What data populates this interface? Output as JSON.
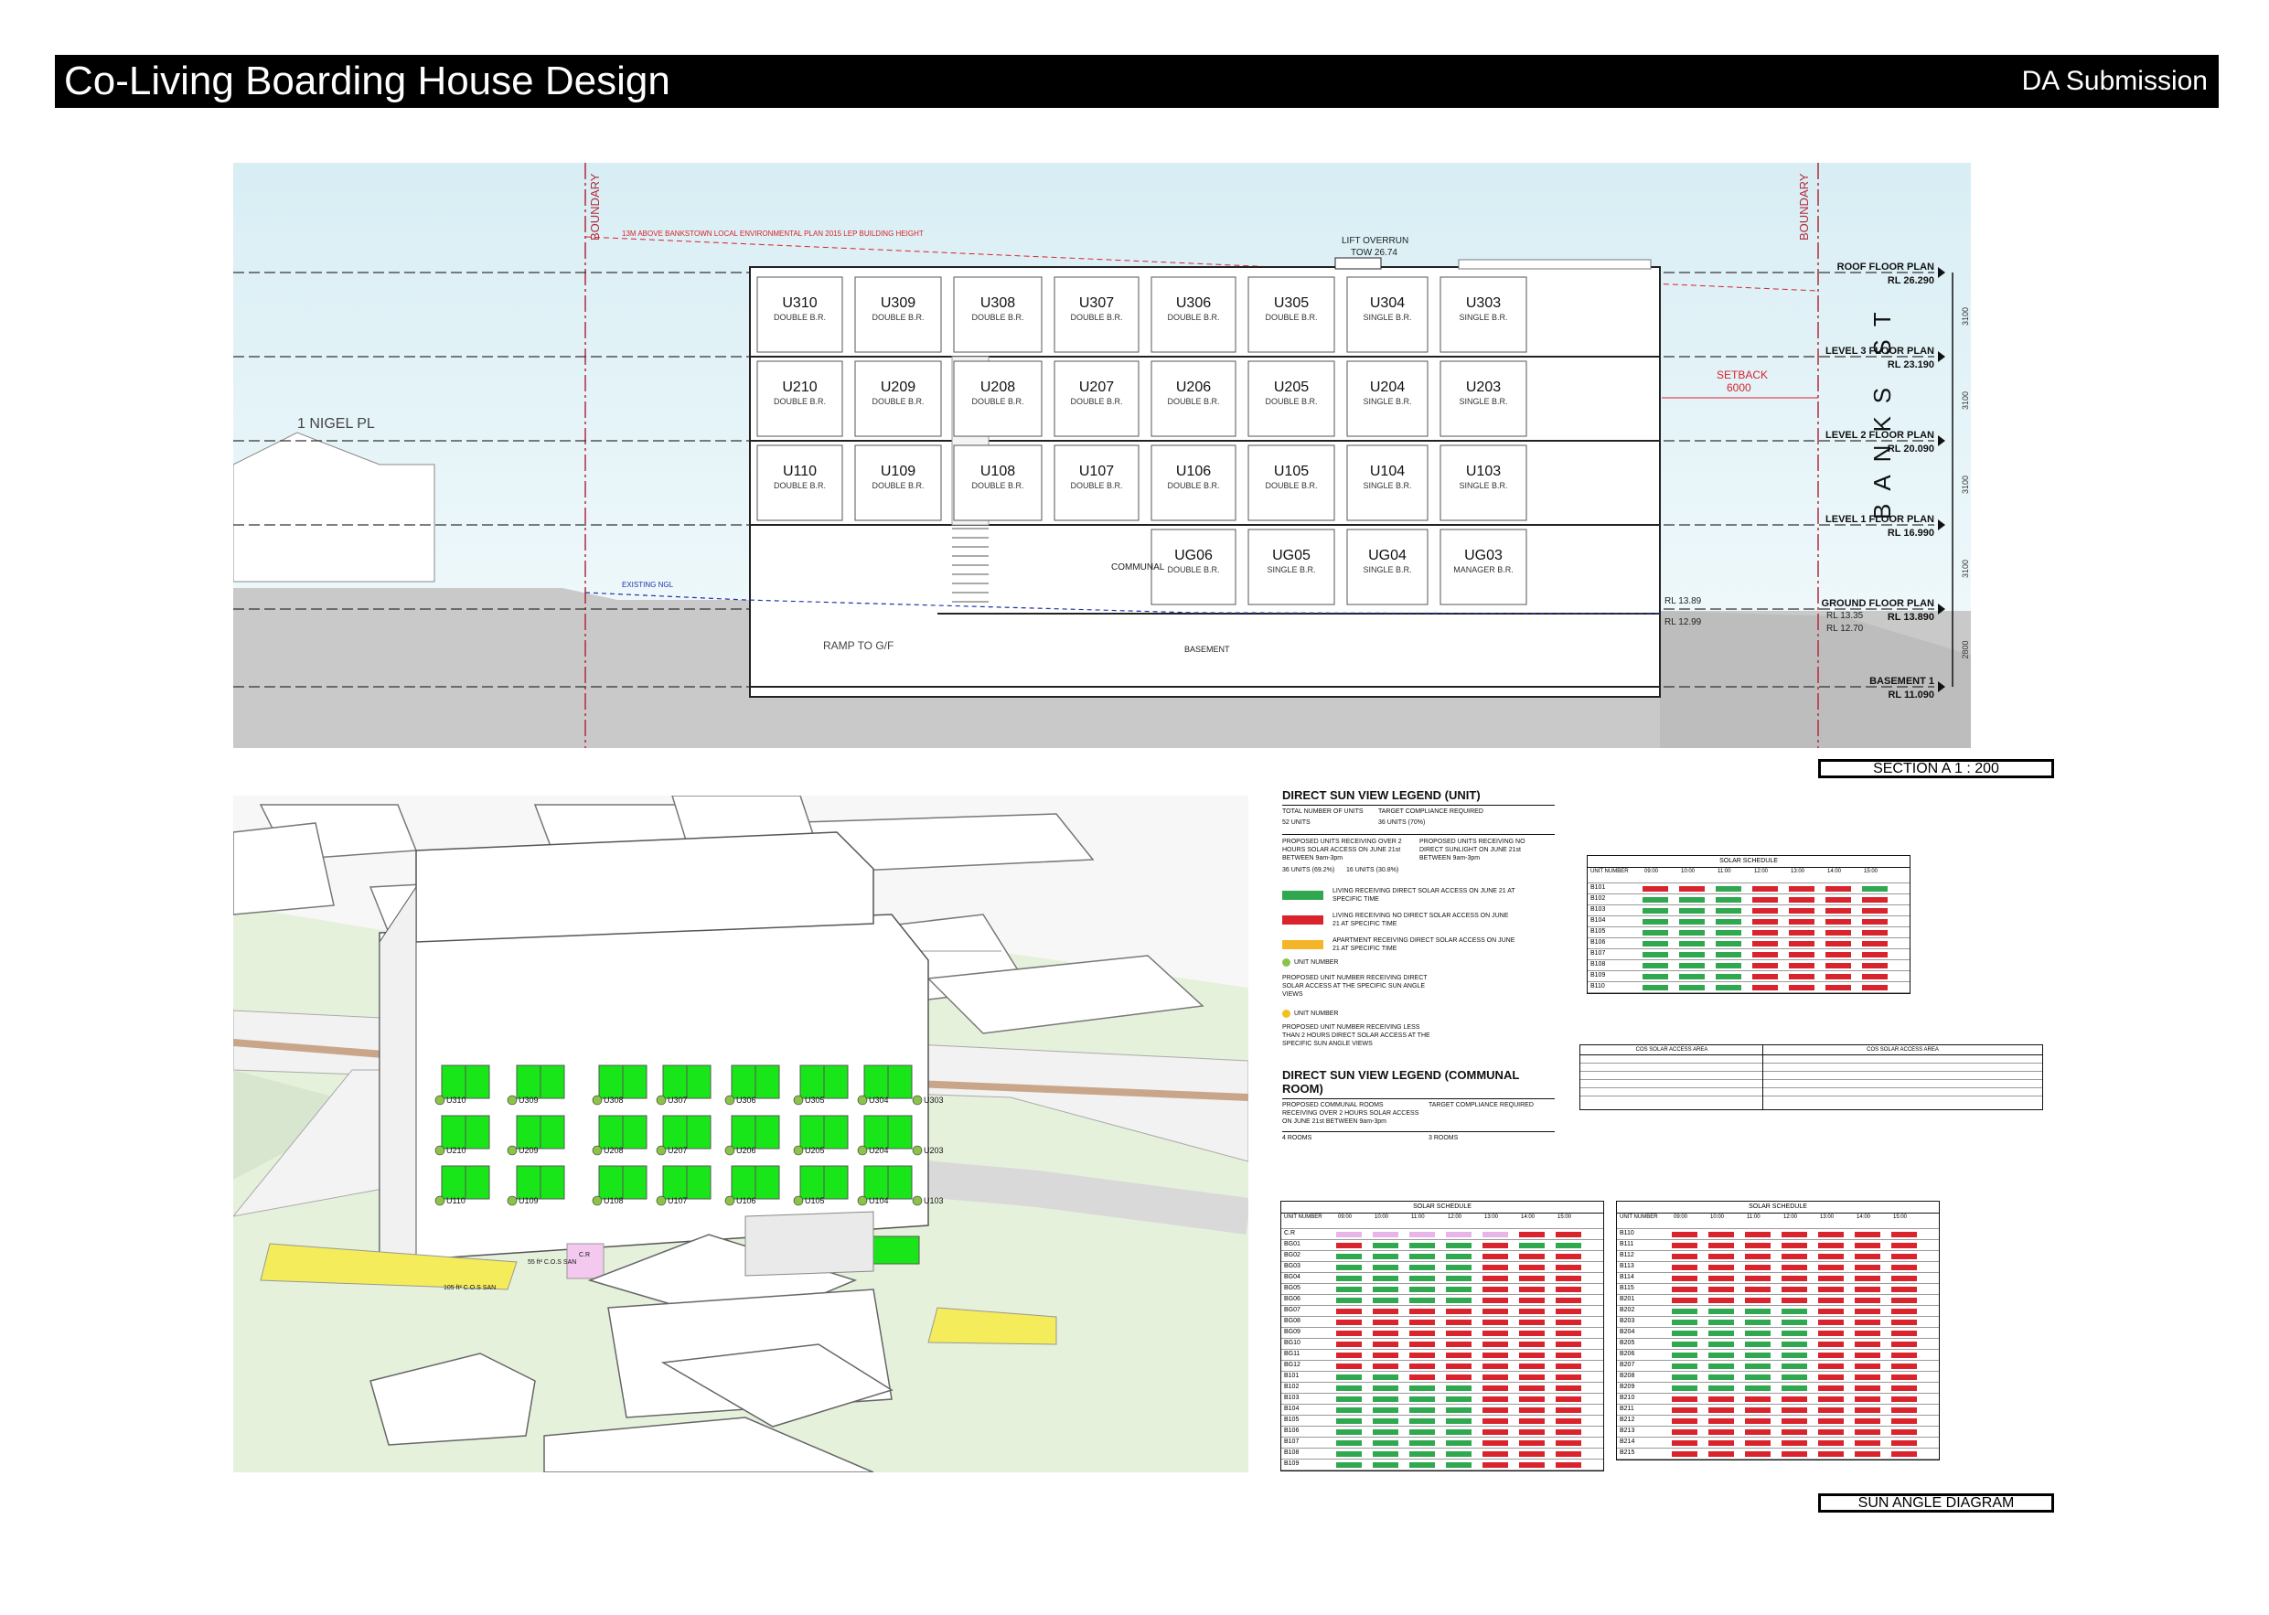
{
  "header": {
    "title": "Co-Living Boarding House Design",
    "subtitle": "DA Submission"
  },
  "section": {
    "boundary_label": "BOUNDARY",
    "height_limit_note": "13M ABOVE BANKSTOWN LOCAL ENVIRONMENTAL PLAN 2015 LEP BUILDING HEIGHT",
    "lift_overrun": "LIFT OVERRUN",
    "tow": "TOW 26.74",
    "neighbour": "1 NIGEL PL",
    "street": "BANKS ST",
    "setback": "SETBACK",
    "setback_value": "6000",
    "existing_ngl": "EXISTING NGL",
    "ramp": "RAMP TO G/F",
    "basement": "BASEMENT",
    "communal": "COMMUNAL",
    "rl_left_1": "RL 13.89",
    "rl_left_2": "RL 12.99",
    "rl_right_1": "RL 13.35",
    "rl_right_2": "RL 12.70",
    "levels": [
      {
        "name": "ROOF FLOOR PLAN",
        "rl": "RL 26.290"
      },
      {
        "name": "LEVEL 3 FLOOR PLAN",
        "rl": "RL 23.190"
      },
      {
        "name": "LEVEL 2 FLOOR PLAN",
        "rl": "RL 20.090"
      },
      {
        "name": "LEVEL 1 FLOOR PLAN",
        "rl": "RL 16.990"
      },
      {
        "name": "GROUND FLOOR PLAN",
        "rl": "RL 13.890"
      },
      {
        "name": "BASEMENT 1",
        "rl": "RL 11.090"
      }
    ],
    "dims": [
      "3100",
      "3100",
      "3100",
      "3100",
      "2800"
    ],
    "units_l3": [
      {
        "id": "U310",
        "type": "DOUBLE B.R."
      },
      {
        "id": "U309",
        "type": "DOUBLE B.R."
      },
      {
        "id": "U308",
        "type": "DOUBLE B.R."
      },
      {
        "id": "U307",
        "type": "DOUBLE B.R."
      },
      {
        "id": "U306",
        "type": "DOUBLE B.R."
      },
      {
        "id": "U305",
        "type": "DOUBLE B.R."
      },
      {
        "id": "U304",
        "type": "SINGLE B.R."
      },
      {
        "id": "U303",
        "type": "SINGLE B.R."
      }
    ],
    "units_l2": [
      {
        "id": "U210",
        "type": "DOUBLE B.R."
      },
      {
        "id": "U209",
        "type": "DOUBLE B.R."
      },
      {
        "id": "U208",
        "type": "DOUBLE B.R."
      },
      {
        "id": "U207",
        "type": "DOUBLE B.R."
      },
      {
        "id": "U206",
        "type": "DOUBLE B.R."
      },
      {
        "id": "U205",
        "type": "DOUBLE B.R."
      },
      {
        "id": "U204",
        "type": "SINGLE B.R."
      },
      {
        "id": "U203",
        "type": "SINGLE B.R."
      }
    ],
    "units_l1": [
      {
        "id": "U110",
        "type": "DOUBLE B.R."
      },
      {
        "id": "U109",
        "type": "DOUBLE B.R."
      },
      {
        "id": "U108",
        "type": "DOUBLE B.R."
      },
      {
        "id": "U107",
        "type": "DOUBLE B.R."
      },
      {
        "id": "U106",
        "type": "DOUBLE B.R."
      },
      {
        "id": "U105",
        "type": "DOUBLE B.R."
      },
      {
        "id": "U104",
        "type": "SINGLE B.R."
      },
      {
        "id": "U103",
        "type": "SINGLE B.R."
      }
    ],
    "units_g": [
      {
        "id": "UG06",
        "type": "DOUBLE B.R."
      },
      {
        "id": "UG05",
        "type": "SINGLE B.R."
      },
      {
        "id": "UG04",
        "type": "SINGLE B.R."
      },
      {
        "id": "UG03",
        "type": "MANAGER B.R."
      }
    ],
    "caption": "SECTION A 1 : 200"
  },
  "aerial": {
    "unit_tags": [
      "U310",
      "U309",
      "U308",
      "U307",
      "U306",
      "U305",
      "U304",
      "U303",
      "U210",
      "U209",
      "U208",
      "U207",
      "U206",
      "U205",
      "U204",
      "U203",
      "U110",
      "U109",
      "U108",
      "U107",
      "U106",
      "U105",
      "U104",
      "U103"
    ],
    "cos_small": "55 ft² C.O.S SAN",
    "cos_main": "105 ft² C.O.S SAN",
    "cr": "C.R"
  },
  "legend_unit": {
    "title": "DIRECT SUN VIEW LEGEND (UNIT)",
    "row1a": "TOTAL NUMBER OF UNITS",
    "row1b": "TARGET COMPLIANCE REQUIRED",
    "row2a": "52 UNITS",
    "row2b": "36 UNITS (70%)",
    "row3a": "PROPOSED UNITS RECEIVING OVER 2 HOURS SOLAR ACCESS ON JUNE 21st BETWEEN 9am-3pm",
    "row3b": "PROPOSED UNITS RECEIVING NO DIRECT SUNLIGHT ON JUNE 21st BETWEEN 9am-3pm",
    "row4a": "36 UNITS (69.2%)",
    "row4b": "16 UNITS (30.8%)",
    "green_text": "LIVING RECEIVING DIRECT SOLAR ACCESS ON JUNE 21 AT SPECIFIC TIME",
    "red_text": "LIVING RECEIVING NO DIRECT SOLAR ACCESS ON JUNE 21 AT SPECIFIC TIME",
    "yellow_text": "APARTMENT RECEIVING DIRECT SOLAR ACCESS ON JUNE 21 AT SPECIFIC TIME",
    "tick_label": "UNIT NUMBER",
    "tick_text": "PROPOSED UNIT NUMBER RECEIVING DIRECT SOLAR ACCESS AT THE SPECIFIC SUN ANGLE VIEWS",
    "tick2_label": "UNIT NUMBER",
    "tick2_text": "PROPOSED UNIT NUMBER RECEIVING LESS THAN 2 HOURS DIRECT SOLAR ACCESS AT THE SPECIFIC SUN ANGLE VIEWS"
  },
  "legend_comm": {
    "title": "DIRECT SUN VIEW LEGEND (COMMUNAL ROOM)",
    "row1a": "PROPOSED COMMUNAL ROOMS RECEIVING OVER 2 HOURS SOLAR ACCESS ON JUNE 21st BETWEEN 9am-3pm",
    "row1b": "TARGET COMPLIANCE REQUIRED",
    "row2a": "4 ROOMS",
    "row2b": "3 ROOMS"
  },
  "schedule_cap": "SOLAR SCHEDULE",
  "sched_head": [
    "UNIT NUMBER",
    "09:00",
    "10:00",
    "11:00",
    "12:00",
    "13:00",
    "14:00",
    "15:00"
  ],
  "schedule1": {
    "rows": [
      {
        "u": "B101",
        "c": "rrgrrrg"
      },
      {
        "u": "B102",
        "c": "gggrrrr"
      },
      {
        "u": "B103",
        "c": "gggrrrr"
      },
      {
        "u": "B104",
        "c": "gggrrrr"
      },
      {
        "u": "B105",
        "c": "gggrrrr"
      },
      {
        "u": "B106",
        "c": "gggrrrr"
      },
      {
        "u": "B107",
        "c": "gggrrrr"
      },
      {
        "u": "B108",
        "c": "gggrrrr"
      },
      {
        "u": "B109",
        "c": "gggrrrr"
      },
      {
        "u": "B110",
        "c": "gggrrrr"
      }
    ]
  },
  "schedule2": {
    "rows": [
      {
        "u": "C.R",
        "c": "ppppprr"
      },
      {
        "u": "BG01",
        "c": "rgggrgg"
      },
      {
        "u": "BG02",
        "c": "ggggrrr"
      },
      {
        "u": "BG03",
        "c": "ggggrrr"
      },
      {
        "u": "BG04",
        "c": "ggggrrr"
      },
      {
        "u": "BG05",
        "c": "ggggrrr"
      },
      {
        "u": "BG06",
        "c": "ggggrrr"
      },
      {
        "u": "BG07",
        "c": "rrrrrrr"
      },
      {
        "u": "BG08",
        "c": "rrrrrrr"
      },
      {
        "u": "BG09",
        "c": "rrrrrrr"
      },
      {
        "u": "BG10",
        "c": "rrrrrrr"
      },
      {
        "u": "BG11",
        "c": "rrrrrrr"
      },
      {
        "u": "BG12",
        "c": "rrrrrrr"
      },
      {
        "u": "B101",
        "c": "ggrrrrr"
      },
      {
        "u": "B102",
        "c": "ggggrrr"
      },
      {
        "u": "B103",
        "c": "ggggrrr"
      },
      {
        "u": "B104",
        "c": "ggggrrr"
      },
      {
        "u": "B105",
        "c": "ggggrrr"
      },
      {
        "u": "B106",
        "c": "ggggrrr"
      },
      {
        "u": "B107",
        "c": "ggggrrr"
      },
      {
        "u": "B108",
        "c": "ggggrrr"
      },
      {
        "u": "B109",
        "c": "ggggrrr"
      }
    ]
  },
  "schedule3": {
    "rows": [
      {
        "u": "B110",
        "c": "rrrrrrr"
      },
      {
        "u": "B111",
        "c": "rrrrrrr"
      },
      {
        "u": "B112",
        "c": "rrrrrrr"
      },
      {
        "u": "B113",
        "c": "rrrrrrr"
      },
      {
        "u": "B114",
        "c": "rrrrrrr"
      },
      {
        "u": "B115",
        "c": "rrrrrrr"
      },
      {
        "u": "B201",
        "c": "rrrrrrr"
      },
      {
        "u": "B202",
        "c": "ggggrrr"
      },
      {
        "u": "B203",
        "c": "ggggrrr"
      },
      {
        "u": "B204",
        "c": "ggggrrr"
      },
      {
        "u": "B205",
        "c": "ggggrrr"
      },
      {
        "u": "B206",
        "c": "ggggrrr"
      },
      {
        "u": "B207",
        "c": "ggggrrr"
      },
      {
        "u": "B208",
        "c": "ggggrrr"
      },
      {
        "u": "B209",
        "c": "ggggrrr"
      },
      {
        "u": "B210",
        "c": "rrrrrrr"
      },
      {
        "u": "B211",
        "c": "rrrrrrr"
      },
      {
        "u": "B212",
        "c": "rrrrrrr"
      },
      {
        "u": "B213",
        "c": "rrrrrrr"
      },
      {
        "u": "B214",
        "c": "rrrrrrr"
      },
      {
        "u": "B215",
        "c": "rrrrrrr"
      }
    ]
  },
  "cos_table_1": "COS SOLAR ACCESS AREA",
  "cos_table_2": "COS SOLAR ACCESS AREA",
  "caption2": "SUN ANGLE DIAGRAM",
  "colors": {
    "green": "#2fa84f",
    "red": "#d9232d",
    "sky": "#ddf1f6",
    "ground": "#c8c8c8",
    "grass": "#e2f0d6",
    "window": "#19e619",
    "yellow": "#f4ec5a"
  }
}
